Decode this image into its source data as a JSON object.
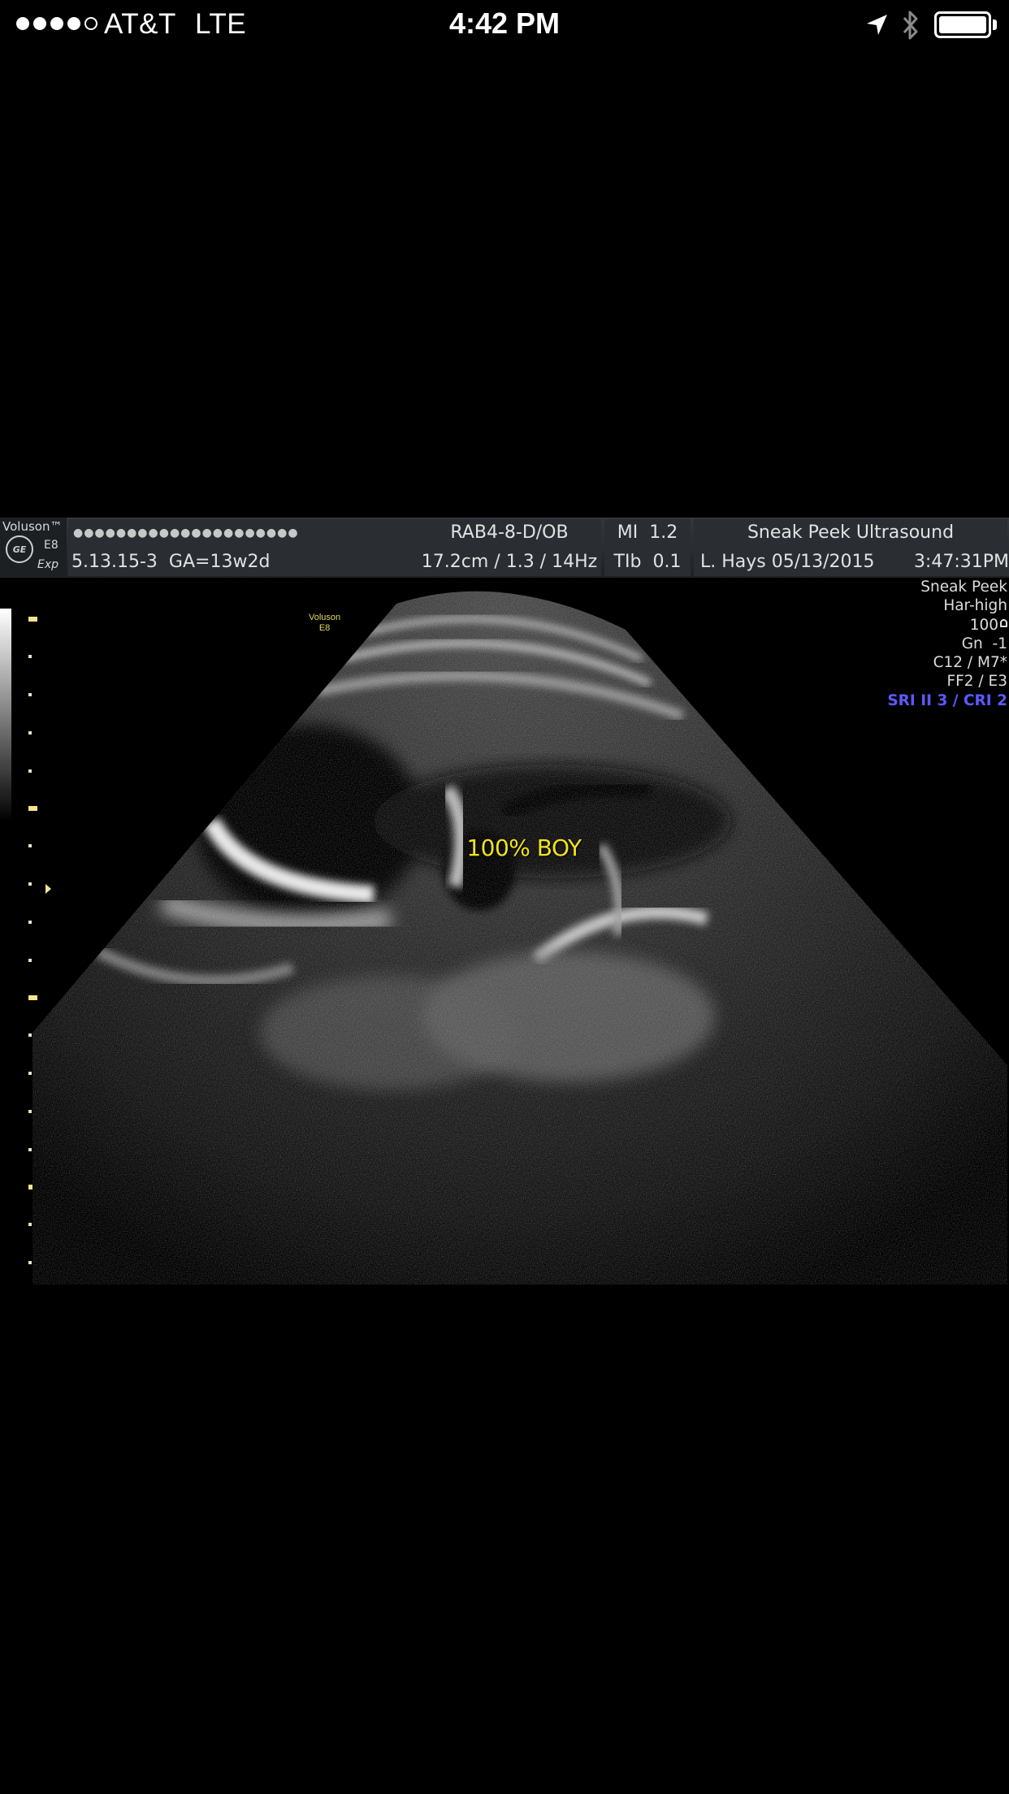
{
  "status_bar": {
    "signal": {
      "filled": 4,
      "total": 5
    },
    "carrier": "AT&T",
    "network": "LTE",
    "time": "4:42 PM",
    "icons": [
      "location-arrow-icon",
      "bluetooth-icon",
      "battery-icon"
    ],
    "battery_level": 1.0
  },
  "ultrasound": {
    "header": {
      "brand": "Voluson™",
      "model": "E8",
      "model_sub": "Exp",
      "patient_id_masked": "●●●●●●●●●●●●●●●●●●●●●",
      "exam_id": "5.13.15-3",
      "gestational_age": "GA=13w2d",
      "probe": "RAB4-8-D/OB",
      "depth_freq": "17.2cm / 1.3 / 14Hz",
      "mi": "MI",
      "mi_value": "1.2",
      "tib": "TIb",
      "tib_value": "0.1",
      "facility": "Sneak Peek Ultrasound",
      "operator_date": "L. Hays 05/13/2015",
      "clock": "3:47:31PM"
    },
    "probe_marker": {
      "line1": "Voluson",
      "line2": "E8"
    },
    "annotation": "100% BOY",
    "parameters": {
      "preset": "Sneak Peek",
      "harmonics": "Har-high",
      "power": "100",
      "gain": "Gn  -1",
      "map": "C12 / M7*",
      "frame": "FF2 / E3",
      "sri": "SRI II 3 / CRI 2"
    },
    "colors": {
      "annotation": "#f1e21f",
      "sri": "#5a5aff",
      "tick": "#f7e48a"
    }
  }
}
